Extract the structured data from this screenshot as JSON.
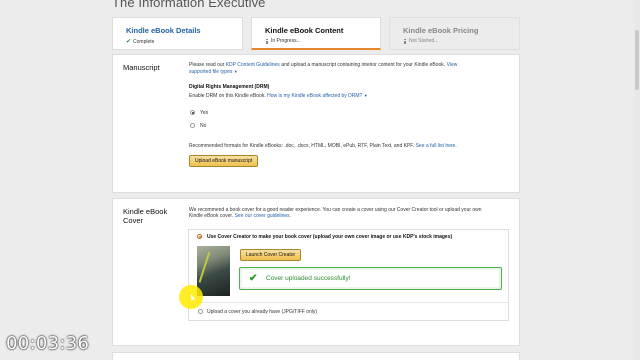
{
  "page": {
    "title": "The Information Executive"
  },
  "tabs": [
    {
      "title": "Kindle eBook Details",
      "status": "Complete"
    },
    {
      "title": "Kindle eBook Content",
      "status": "In Progress..."
    },
    {
      "title": "Kindle eBook Pricing",
      "status": "Not Started..."
    }
  ],
  "manuscript": {
    "heading": "Manuscript",
    "intro_pre": "Please read our ",
    "intro_link1": "KDP Content Guidelines",
    "intro_mid": " and upload a manuscript containing interior content for your Kindle eBook. ",
    "intro_link2_a": "View",
    "intro_link2_b": "supported file types",
    "drm_heading": "Digital Rights Management (DRM)",
    "drm_question": "Enable DRM on this Kindle eBook. ",
    "drm_link": "How is my Kindle eBook affected by DRM?",
    "opt_yes": "Yes",
    "opt_no": "No",
    "formats_text": "Recommended formats for Kindle eBooks: .doc, .docx, HTML, MOBI, ePub, RTF, Plain Text, and KPF. ",
    "formats_link": "See a full list here.",
    "upload_button": "Upload eBook manuscript"
  },
  "cover": {
    "heading_line1": "Kindle eBook",
    "heading_line2": "Cover",
    "intro_line1": "We recommend a book cover for a good reader experience. You can create a cover using our Cover Creator tool or upload your own",
    "intro_line2_pre": "Kindle eBook cover. ",
    "intro_line2_link": "See our cover guidelines.",
    "option_creator": "Use Cover Creator to make your book cover (upload your own cover image or use KDP's stock images)",
    "launch_button": "Launch Cover Creator",
    "success_message": "Cover uploaded successfully!",
    "option_upload": "Upload a cover you already have (JPG/TIFF only)"
  },
  "overlay": {
    "timer": "00:03:36"
  },
  "colors": {
    "link": "#2461a8",
    "accent_orange": "#e4862a",
    "success_green": "#2e9a2e",
    "button_gold": "#f0c14b"
  }
}
